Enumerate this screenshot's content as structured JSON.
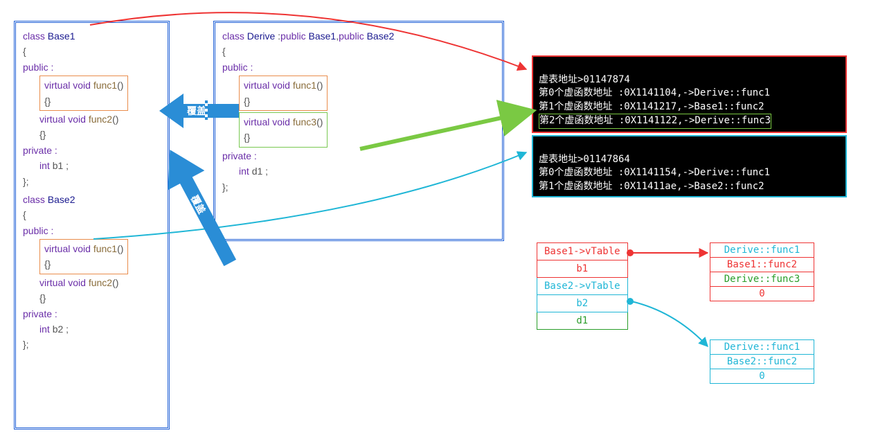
{
  "base1": {
    "decl": "class Base1",
    "open": "{",
    "pub": "public :",
    "f1a": "virtual void func1()",
    "f1b": "{}",
    "f2a": "virtual void func2()",
    "f2b": "{}",
    "priv": "private :",
    "m1": "int b1 ;",
    "close": "};"
  },
  "base2": {
    "decl": "class Base2",
    "open": "{",
    "pub": "public :",
    "f1a": "virtual void func1()",
    "f1b": "{}",
    "f2a": "virtual void func2()",
    "f2b": "{}",
    "priv": "private :",
    "m1": "int b2 ;",
    "close": "};"
  },
  "derive": {
    "decl": "class Derive :public Base1,public Base2",
    "open": "{",
    "pub": "public :",
    "f1a": "virtual void func1()",
    "f1b": "{}",
    "f3a": "virtual void func3()",
    "f3b": "{}",
    "priv": "private :",
    "m1": "int d1 ;",
    "close": "};"
  },
  "console1": {
    "l0": "虚表地址>01147874",
    "l1": "第0个虚函数地址 :0X1141104,->Derive::func1",
    "l2": "第1个虚函数地址 :0X1141217,->Base1::func2",
    "l3": "第2个虚函数地址 :0X1141122,->Derive::func3"
  },
  "console2": {
    "l0": "虚表地址>01147864",
    "l1": "第0个虚函数地址 :0X1141154,->Derive::func1",
    "l2": "第1个虚函数地址 :0X11411ae,->Base2::func2"
  },
  "mem": {
    "r0": "Base1->vTable",
    "r1": "b1",
    "r2": "Base2->vTable",
    "r3": "b2",
    "r4": "d1"
  },
  "vt1": {
    "r0": "Derive::func1",
    "r1": "Base1::func2",
    "r2": "Derive::func3",
    "r3": "0"
  },
  "vt2": {
    "r0": "Derive::func1",
    "r1": "Base2::func2",
    "r2": "0"
  },
  "labels": {
    "override": "覆盖"
  }
}
